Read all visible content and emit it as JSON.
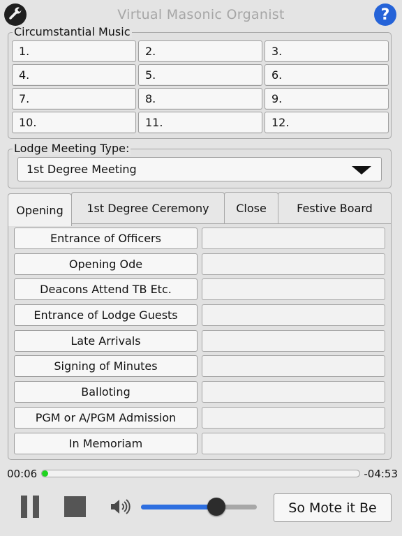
{
  "app": {
    "title": "Virtual Masonic Organist",
    "help_label": "?",
    "wrench_icon": "wrench-icon",
    "help_icon": "help-icon"
  },
  "circumstantial": {
    "label": "Circumstantial Music",
    "slots": [
      {
        "label": "1."
      },
      {
        "label": "2."
      },
      {
        "label": "3."
      },
      {
        "label": "4."
      },
      {
        "label": "5."
      },
      {
        "label": "6."
      },
      {
        "label": "7."
      },
      {
        "label": "8."
      },
      {
        "label": "9."
      },
      {
        "label": "10."
      },
      {
        "label": "11."
      },
      {
        "label": "12."
      }
    ]
  },
  "lodge": {
    "label": "Lodge Meeting Type:",
    "selected": "1st Degree Meeting",
    "dropdown_icon": "triangle-down-icon"
  },
  "tabs": [
    {
      "label": "Opening",
      "active": true
    },
    {
      "label": "1st Degree Ceremony",
      "active": false
    },
    {
      "label": "Close",
      "active": false
    },
    {
      "label": "Festive Board",
      "active": false
    }
  ],
  "events": [
    {
      "label": "Entrance of Officers",
      "value": ""
    },
    {
      "label": "Opening Ode",
      "value": ""
    },
    {
      "label": "Deacons Attend TB Etc.",
      "value": ""
    },
    {
      "label": "Entrance of Lodge Guests",
      "value": ""
    },
    {
      "label": "Late Arrivals",
      "value": ""
    },
    {
      "label": "Signing of Minutes",
      "value": ""
    },
    {
      "label": "Balloting",
      "value": ""
    },
    {
      "label": "PGM or A/PGM Admission",
      "value": ""
    },
    {
      "label": "In Memoriam",
      "value": ""
    }
  ],
  "player": {
    "elapsed": "00:06",
    "remaining": "-04:53",
    "progress_fraction": 0.02,
    "volume_fraction": 0.65,
    "pause_icon": "pause-icon",
    "stop_icon": "stop-icon",
    "volume_icon": "speaker-icon",
    "action_label": "So Mote it Be"
  },
  "colors": {
    "progress": "#1fd41f",
    "volume": "#2e6fe0",
    "help": "#2563d8"
  }
}
